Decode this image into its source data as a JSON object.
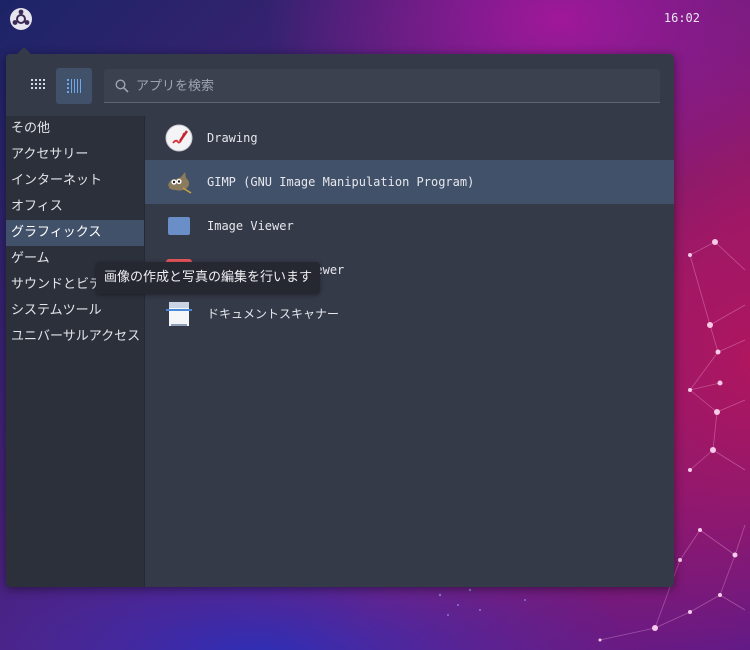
{
  "topbar": {
    "logo_icon": "budgie-logo-icon",
    "clock": "16:02"
  },
  "menu": {
    "view_buttons": [
      {
        "icon": "grid-view-icon",
        "active": false
      },
      {
        "icon": "list-view-icon",
        "active": true
      }
    ],
    "search": {
      "placeholder": "アプリを検索",
      "value": ""
    },
    "categories": [
      {
        "label": "その他",
        "active": false
      },
      {
        "label": "アクセサリー",
        "active": false
      },
      {
        "label": "インターネット",
        "active": false
      },
      {
        "label": "オフィス",
        "active": false
      },
      {
        "label": "グラフィックス",
        "active": true
      },
      {
        "label": "ゲーム",
        "active": false
      },
      {
        "label": "サウンドとビデオ",
        "active": false
      },
      {
        "label": "システムツール",
        "active": false
      },
      {
        "label": "ユニバーサルアクセス",
        "active": false
      }
    ],
    "apps": [
      {
        "label": "Drawing",
        "icon": "drawing-app-icon",
        "active": false
      },
      {
        "label": "GIMP (GNU Image Manipulation Program)",
        "icon": "gimp-app-icon",
        "active": true
      },
      {
        "label": "Image Viewer",
        "icon": "image-viewer-app-icon",
        "active": false
      },
      {
        "label": "gThumb Image Viewer",
        "icon": "gthumb-app-icon",
        "active": false
      },
      {
        "label": "ドキュメントスキャナー",
        "icon": "document-scanner-app-icon",
        "active": false
      }
    ],
    "tooltip": "画像の作成と写真の編集を行います"
  },
  "colors": {
    "panel": "#353a48",
    "sidebar": "#2c303b",
    "selection": "#41516a",
    "tooltip": "#252831"
  }
}
